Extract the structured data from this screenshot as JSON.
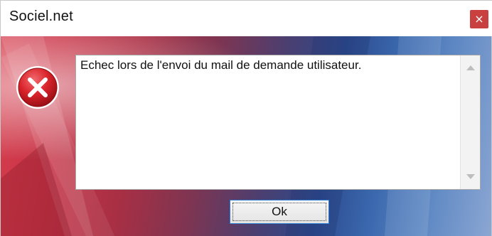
{
  "window": {
    "title": "Sociel.net",
    "close_label": "×"
  },
  "dialog": {
    "icon": "error-icon",
    "message": "Echec lors de l'envoi du mail de demande utilisateur.",
    "ok_label": "Ok"
  },
  "colors": {
    "close_button_bg": "#c8403f",
    "error_icon_red": "#d8232a",
    "focus_border": "#2f7fd0"
  }
}
